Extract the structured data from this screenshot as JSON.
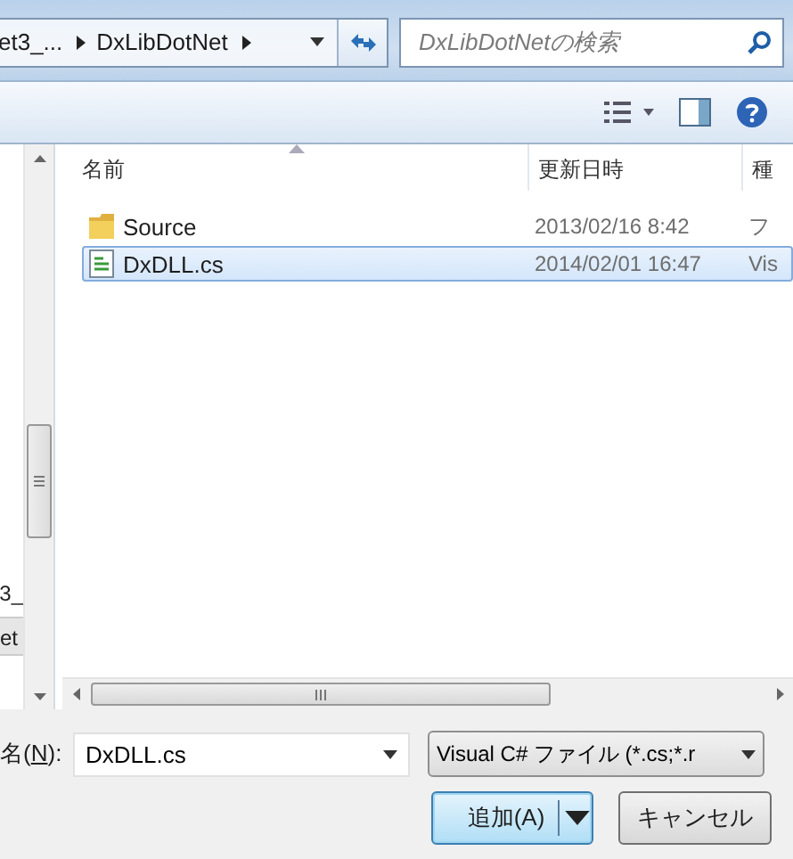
{
  "address_bar": {
    "path": [
      {
        "label": "et3_..."
      },
      {
        "label": "DxLibDotNet"
      }
    ],
    "search": {
      "placeholder": "DxLibDotNetの検索"
    }
  },
  "nav_pane": {
    "items": [
      {
        "label": "3_",
        "selected": false
      },
      {
        "label": "et",
        "selected": true
      }
    ]
  },
  "file_list": {
    "columns": [
      {
        "label": "名前",
        "sorted": true
      },
      {
        "label": "更新日時",
        "sorted": false
      },
      {
        "label": "種",
        "sorted": false
      }
    ],
    "rows": [
      {
        "kind": "folder",
        "name": "Source",
        "modified": "2013/02/16 8:42",
        "type": "フ",
        "selected": false
      },
      {
        "kind": "csharp",
        "name": "DxDLL.cs",
        "modified": "2014/02/01 16:47",
        "type": "Vis",
        "selected": true
      }
    ]
  },
  "filename": {
    "label_before": "名(",
    "mnemonic": "N",
    "label_after": "):",
    "value": "DxDLL.cs"
  },
  "filter": {
    "value": "Visual C# ファイル (*.cs;*.r"
  },
  "buttons": [
    {
      "label": "追加(A)",
      "kind": "split",
      "default": true
    },
    {
      "label": "キャンセル",
      "kind": "plain",
      "default": false
    }
  ]
}
